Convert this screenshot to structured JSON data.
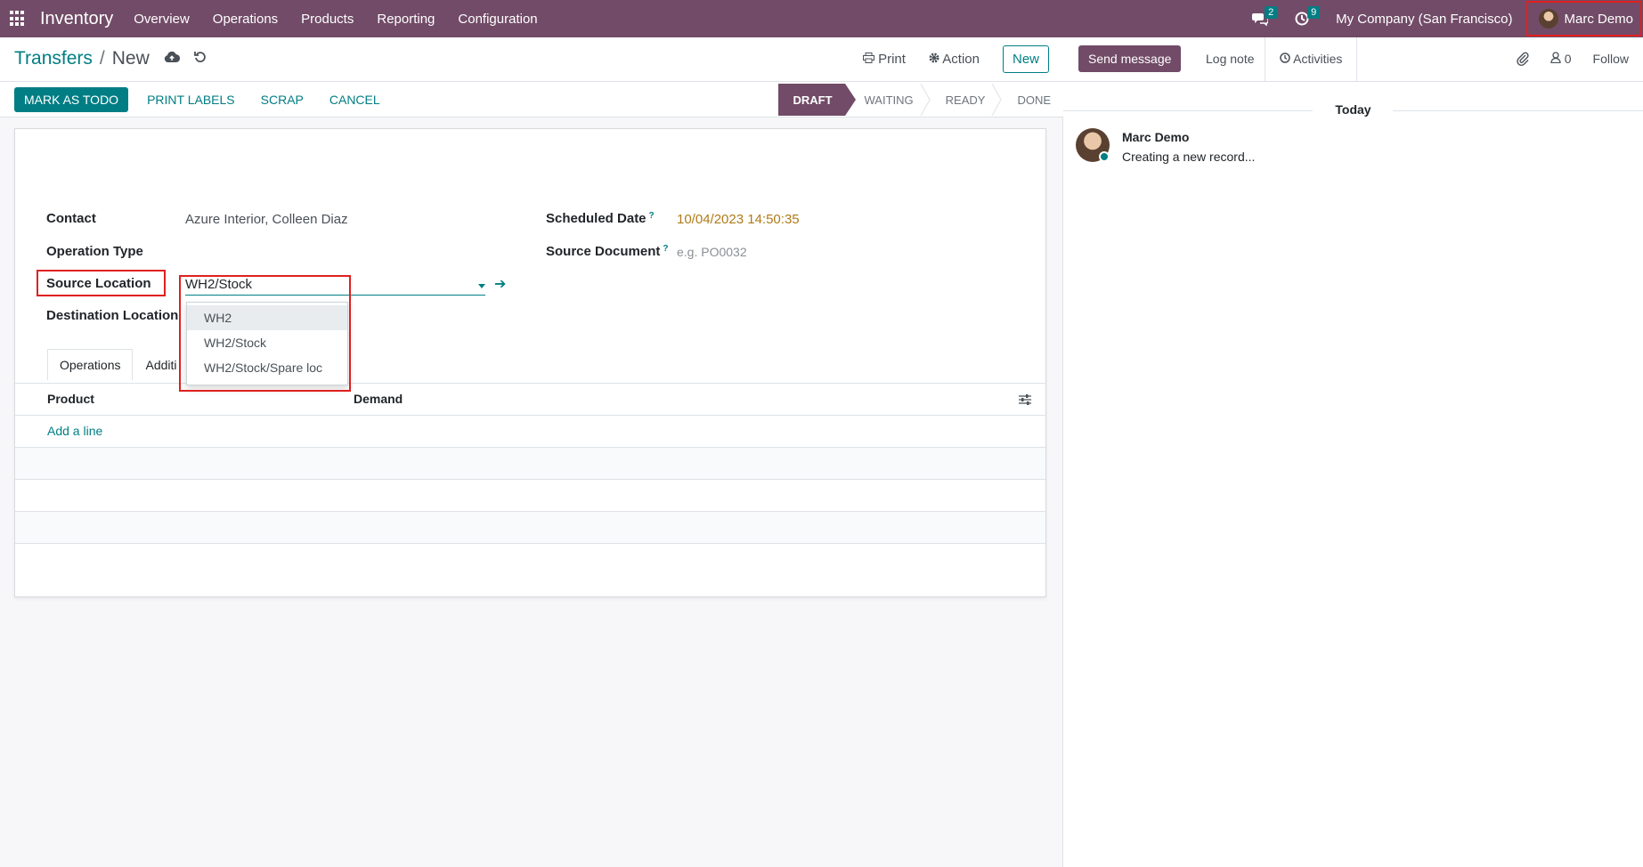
{
  "navbar": {
    "app_name": "Inventory",
    "menu": [
      "Overview",
      "Operations",
      "Products",
      "Reporting",
      "Configuration"
    ],
    "messages_count": "2",
    "activities_count": "9",
    "company": "My Company (San Francisco)",
    "user": "Marc Demo"
  },
  "control_panel": {
    "breadcrumb_parent": "Transfers",
    "breadcrumb_current": "New",
    "print_label": "Print",
    "action_label": "Action",
    "new_label": "New"
  },
  "statusbar": {
    "buttons": [
      "MARK AS TODO",
      "PRINT LABELS",
      "SCRAP",
      "CANCEL"
    ],
    "stages": [
      "DRAFT",
      "WAITING",
      "READY",
      "DONE"
    ],
    "active_stage": "DRAFT"
  },
  "form": {
    "contact_label": "Contact",
    "contact_value": "Azure Interior, Colleen Diaz",
    "operation_type_label": "Operation Type",
    "source_location_label": "Source Location",
    "source_location_value": "WH2/Stock",
    "destination_location_label": "Destination Location",
    "scheduled_date_label": "Scheduled Date",
    "scheduled_date_value": "10/04/2023 14:50:35",
    "source_document_label": "Source Document",
    "source_document_placeholder": "e.g. PO0032",
    "help_mark": "?"
  },
  "dropdown": {
    "options": [
      "WH2",
      "WH2/Stock",
      "WH2/Stock/Spare loc"
    ],
    "highlighted": "WH2"
  },
  "tabs": {
    "operations": "Operations",
    "additional": "Additi"
  },
  "table": {
    "columns": [
      "Product",
      "Demand"
    ],
    "add_line": "Add a line"
  },
  "chatter": {
    "send_message": "Send message",
    "log_note": "Log note",
    "activities": "Activities",
    "followers_count": "0",
    "follow": "Follow",
    "today": "Today",
    "messages": [
      {
        "author": "Marc Demo",
        "body": "Creating a new record..."
      }
    ]
  },
  "colors": {
    "brand": "#714b67",
    "accent": "#017e84",
    "highlight_box": "#e02020",
    "date_value": "#b07a17"
  }
}
